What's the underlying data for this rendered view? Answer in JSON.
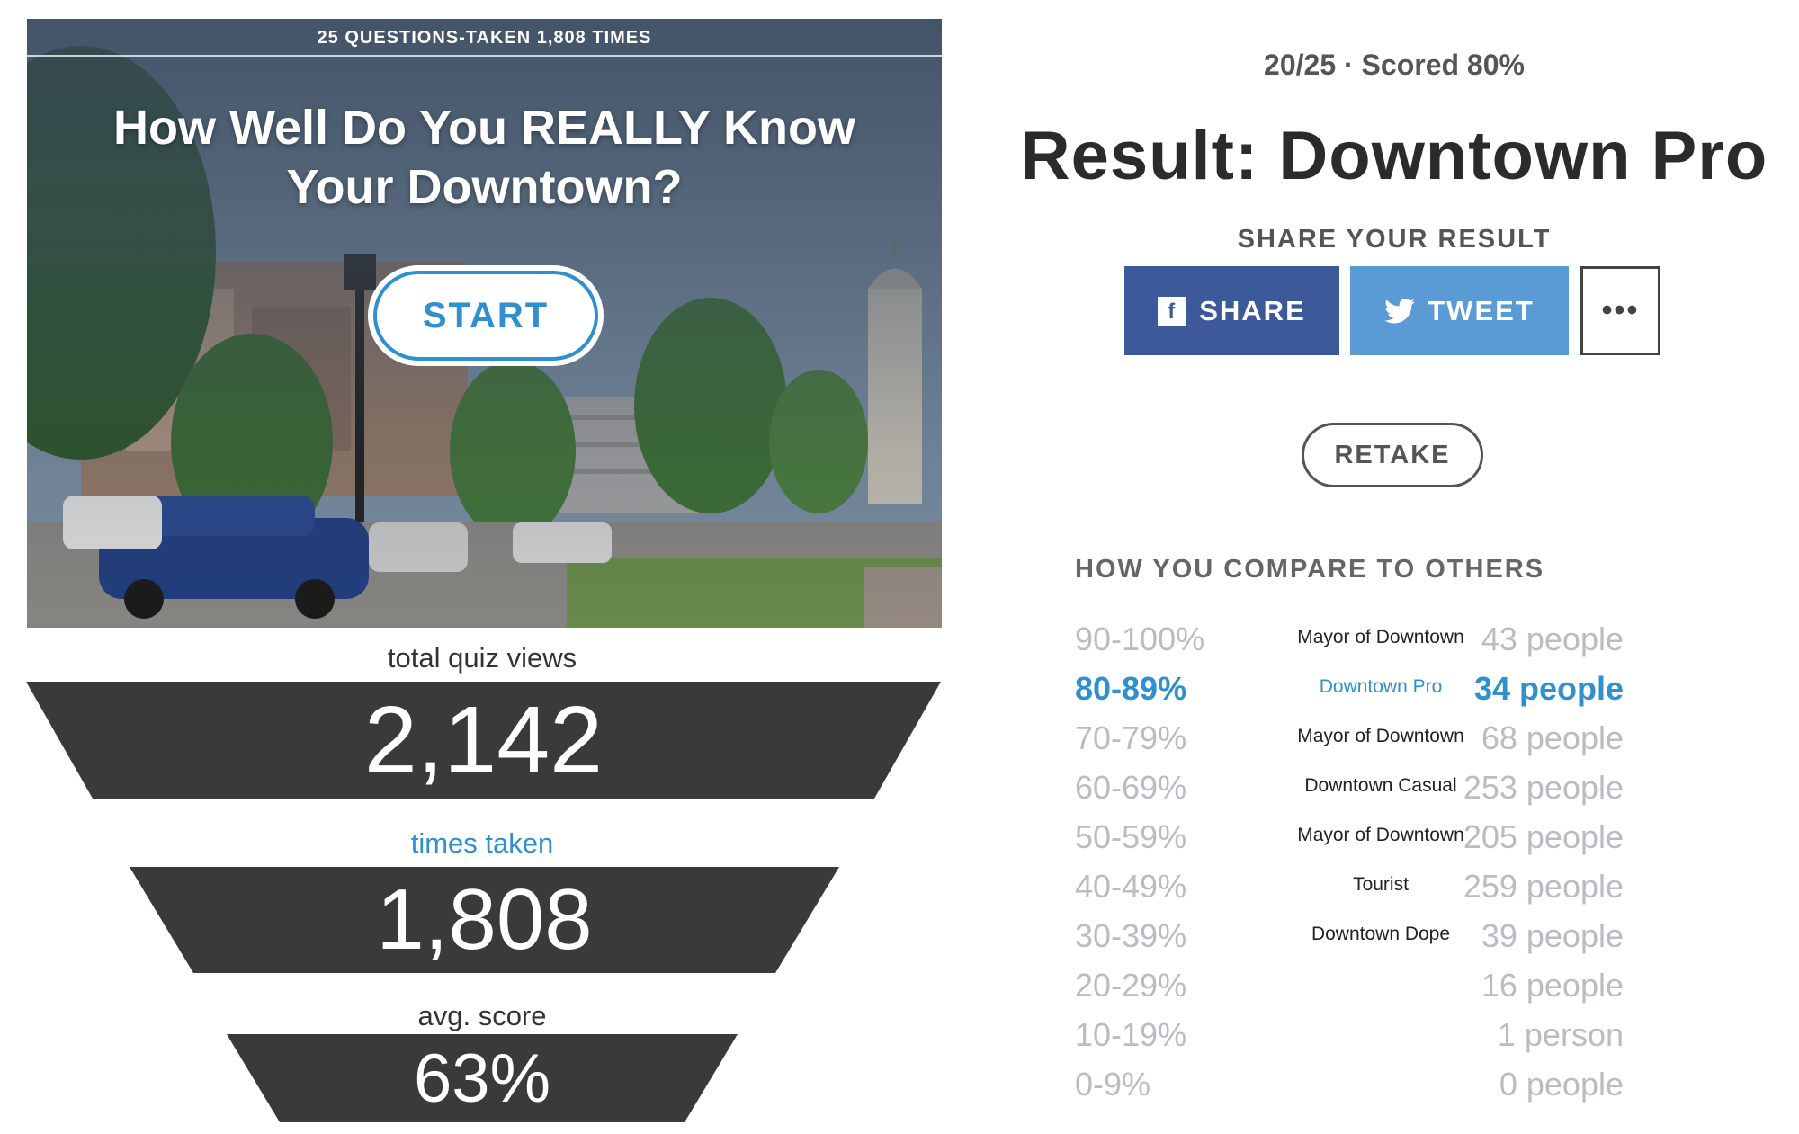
{
  "quiz_card": {
    "meta_line": "25 QUESTIONS-TAKEN 1,808 TIMES",
    "title": "How Well Do You REALLY Know Your Downtown?",
    "start_label": "START"
  },
  "stats": {
    "views_label": "total quiz views",
    "views_value": "2,142",
    "taken_label": "times taken",
    "taken_value": "1,808",
    "score_label": "avg. score",
    "score_value": "63%"
  },
  "result": {
    "score_line": "20/25 · Scored 80%",
    "title": "Result: Downtown Pro",
    "share_heading": "SHARE YOUR RESULT",
    "share_button": "SHARE",
    "tweet_button": "TWEET",
    "more_button": "•••",
    "retake_button": "RETAKE"
  },
  "comparison": {
    "heading": "HOW YOU COMPARE TO OTHERS",
    "rows": [
      {
        "range": "90-100%",
        "label": "Mayor of Downtown",
        "count": "43 people"
      },
      {
        "range": "80-89%",
        "label": "Downtown Pro",
        "count": "34 people",
        "current": true
      },
      {
        "range": "70-79%",
        "label": "Mayor of Downtown",
        "count": "68 people"
      },
      {
        "range": "60-69%",
        "label": "Downtown Casual",
        "count": "253 people"
      },
      {
        "range": "50-59%",
        "label": "Mayor of Downtown",
        "count": "205 people"
      },
      {
        "range": "40-49%",
        "label": "Tourist",
        "count": "259 people"
      },
      {
        "range": "30-39%",
        "label": "Downtown Dope",
        "count": "39 people"
      },
      {
        "range": "20-29%",
        "label": "",
        "count": "16 people"
      },
      {
        "range": "10-19%",
        "label": "",
        "count": "1 person"
      },
      {
        "range": "0-9%",
        "label": "",
        "count": "0 people"
      }
    ]
  },
  "colors": {
    "accent_blue": "#2f8fcf",
    "facebook": "#3c5a9a",
    "twitter": "#5b9bd5",
    "funnel": "#3a3a3c",
    "muted": "#b9bdc3"
  }
}
